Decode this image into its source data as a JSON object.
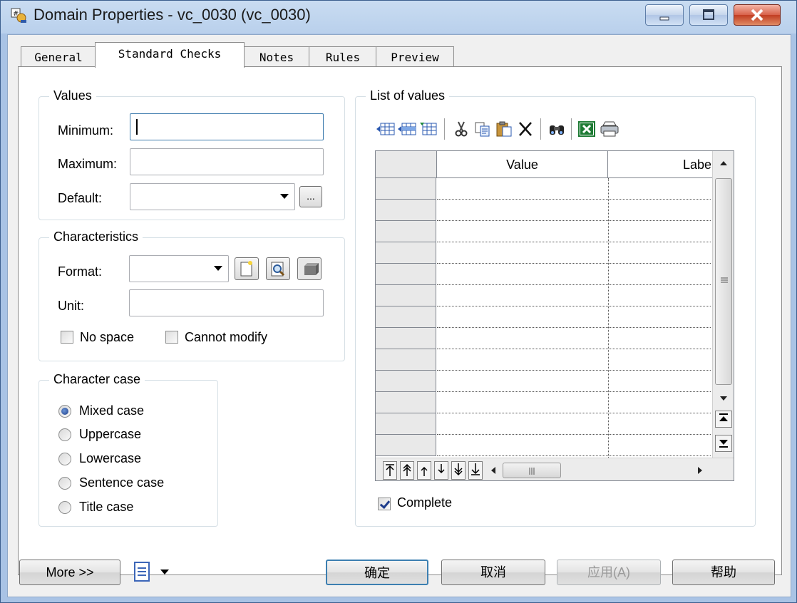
{
  "window": {
    "title": "Domain Properties - vc_0030 (vc_0030)",
    "controls": [
      "minimize-icon",
      "maximize-icon",
      "close-icon"
    ]
  },
  "tabs": [
    {
      "label": "General",
      "active": false
    },
    {
      "label": "Standard Checks",
      "active": true
    },
    {
      "label": "Notes",
      "active": false
    },
    {
      "label": "Rules",
      "active": false
    },
    {
      "label": "Preview",
      "active": false
    }
  ],
  "values_group": {
    "legend": "Values",
    "minimum_label": "Minimum:",
    "minimum_value": "",
    "maximum_label": "Maximum:",
    "maximum_value": "",
    "default_label": "Default:",
    "default_value": "",
    "ellipsis_label": "..."
  },
  "characteristics_group": {
    "legend": "Characteristics",
    "format_label": "Format:",
    "format_value": "",
    "unit_label": "Unit:",
    "unit_value": "",
    "no_space_label": "No space",
    "no_space_checked": false,
    "cannot_modify_label": "Cannot modify",
    "cannot_modify_checked": false
  },
  "character_case_group": {
    "legend": "Character case",
    "options": [
      {
        "label": "Mixed case",
        "selected": true
      },
      {
        "label": "Uppercase",
        "selected": false
      },
      {
        "label": "Lowercase",
        "selected": false
      },
      {
        "label": "Sentence case",
        "selected": false
      },
      {
        "label": "Title case",
        "selected": false
      }
    ]
  },
  "list_of_values": {
    "legend": "List of values",
    "toolbar": [
      "add-row-icon",
      "insert-row-icon",
      "add-rows-icon",
      "cut-icon",
      "copy-icon",
      "paste-icon",
      "delete-icon",
      "find-icon",
      "excel-icon",
      "print-icon"
    ],
    "columns": [
      "Value",
      "Labe"
    ],
    "row_count": 13,
    "complete_label": "Complete",
    "complete_checked": true
  },
  "footer": {
    "more_label": "More >>",
    "ok_label": "确定",
    "cancel_label": "取消",
    "apply_label": "应用(A)",
    "help_label": "帮助"
  },
  "colors": {
    "titlebar": "#b9d0ec",
    "client_bg": "#f0f0f0",
    "page_bg": "#ffffff",
    "close_red": "#c13d22",
    "default_button_border": "#3c7fb1",
    "excel_green": "#1e7b34"
  }
}
